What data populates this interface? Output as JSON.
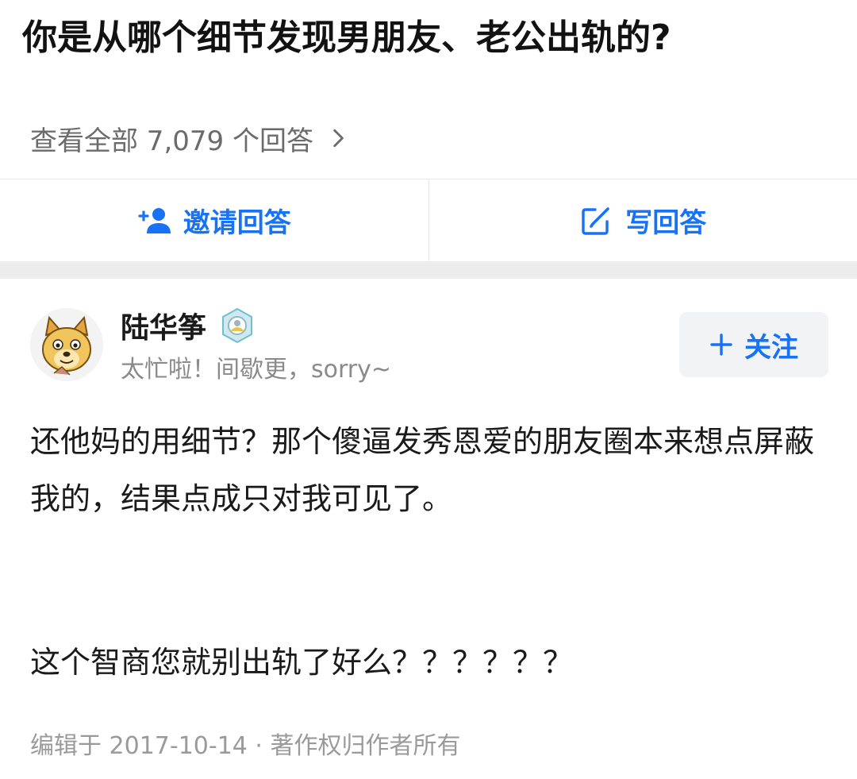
{
  "question": {
    "title": "你是从哪个细节发现男朋友、老公出轨的?",
    "all_answers_label": "查看全部 7,079 个回答"
  },
  "actions": {
    "invite_label": "邀请回答",
    "write_label": "写回答"
  },
  "author": {
    "name": "陆华筝",
    "bio": "太忙啦！间歇更，sorry~",
    "follow_label": "关注"
  },
  "answer": {
    "paragraphs": [
      "还他妈的用细节？那个傻逼发秀恩爱的朋友圈本来想点屏蔽我的，结果点成只对我可见了。",
      "这个智商您就别出轨了好么？？？？？？"
    ],
    "footer": "编辑于 2017-10-14 · 著作权归作者所有"
  },
  "colors": {
    "accent": "#1772f6",
    "muted": "#8a8a8a",
    "separator": "#ececec"
  },
  "icons": {
    "invite": "add-person-icon",
    "write": "edit-icon",
    "follow": "plus-icon",
    "more": "chevron-right-icon",
    "badge": "creator-badge-icon"
  }
}
